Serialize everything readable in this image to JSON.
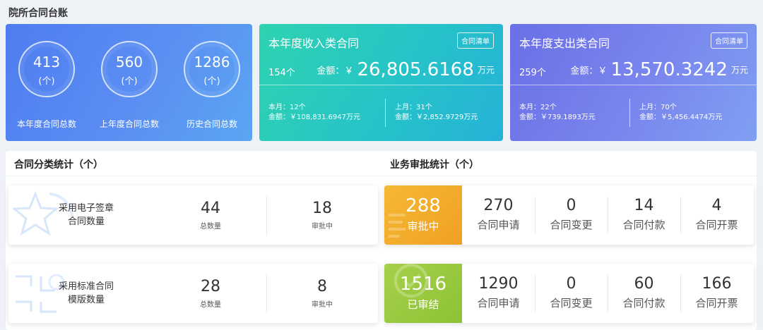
{
  "page": {
    "title": "院所合同台账"
  },
  "overview": {
    "stats": [
      {
        "value": "413",
        "unit": "(个)",
        "label": "本年度合同总数"
      },
      {
        "value": "560",
        "unit": "(个)",
        "label": "上年度合同总数"
      },
      {
        "value": "1286",
        "unit": "(个)",
        "label": "历史合同总数"
      }
    ]
  },
  "income": {
    "title": "本年度收入类合同",
    "list_button": "合同清单",
    "count": "154个",
    "amount_label": "金额：￥",
    "amount": "26,805.6168",
    "amount_unit": "万元",
    "this_month_count": "本月：12个",
    "this_month_amount": "金额：￥108,831.6947万元",
    "last_month_count": "上月：31个",
    "last_month_amount": "金额：￥2,852.9729万元"
  },
  "expense": {
    "title": "本年度支出类合同",
    "list_button": "合同清单",
    "count": "259个",
    "amount_label": "金额：￥",
    "amount": "13,570.3242",
    "amount_unit": "万元",
    "this_month_count": "本月：22个",
    "this_month_amount": "金额：￥739.1893万元",
    "last_month_count": "上月：70个",
    "last_month_amount": "金额：￥5,456.4474万元"
  },
  "category": {
    "title": "合同分类统计（个）",
    "rows": [
      {
        "label": "采用电子签章\n合同数量",
        "total": "44",
        "total_label": "总数量",
        "pending": "18",
        "pending_label": "审批中"
      },
      {
        "label": "采用标准合同\n模版数量",
        "total": "28",
        "total_label": "总数量",
        "pending": "8",
        "pending_label": "审批中"
      }
    ]
  },
  "audit": {
    "title": "业务审批统计（个）",
    "rows": [
      {
        "head_value": "288",
        "head_label": "审批中",
        "color": "#f0a023",
        "items": [
          {
            "value": "270",
            "label": "合同申请"
          },
          {
            "value": "0",
            "label": "合同变更"
          },
          {
            "value": "14",
            "label": "合同付款"
          },
          {
            "value": "4",
            "label": "合同开票"
          }
        ]
      },
      {
        "head_value": "1516",
        "head_label": "已审结",
        "color": "#8cc236",
        "items": [
          {
            "value": "1290",
            "label": "合同申请"
          },
          {
            "value": "0",
            "label": "合同变更"
          },
          {
            "value": "60",
            "label": "合同付款"
          },
          {
            "value": "166",
            "label": "合同开票"
          }
        ]
      }
    ]
  },
  "colors": {
    "primary_blue": "#5b8ef2",
    "income_teal": "#27c3c8",
    "expense_purple": "#7a86ee",
    "pending_orange": "#f0a023",
    "done_green": "#8cc236"
  }
}
